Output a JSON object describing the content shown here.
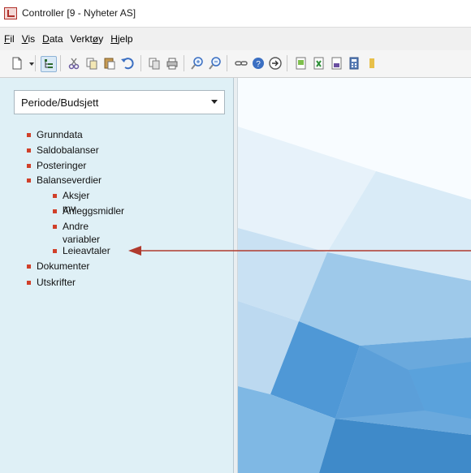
{
  "window": {
    "title": "Controller [9 - Nyheter AS]",
    "icon": "app-icon"
  },
  "menubar": {
    "items": [
      {
        "pre": "",
        "key": "F",
        "post": "il"
      },
      {
        "pre": "",
        "key": "V",
        "post": "is"
      },
      {
        "pre": "",
        "key": "D",
        "post": "ata"
      },
      {
        "pre": "Verkt",
        "key": "ø",
        "post": "y"
      },
      {
        "pre": "",
        "key": "H",
        "post": "jelp"
      }
    ]
  },
  "toolbar": {
    "icons": [
      "new-document-icon",
      "dropdown-arrow-icon",
      "tree-view-icon",
      "cut-icon",
      "copy-icon",
      "paste-icon",
      "undo-icon",
      "copy-report-icon",
      "print-icon",
      "zoom-in-icon",
      "zoom-out-icon",
      "link-icon",
      "help-icon",
      "forward-icon",
      "import-icon",
      "excel-icon",
      "report-icon",
      "calculator-icon"
    ]
  },
  "sidebar": {
    "dropdown": {
      "selected": "Periode/Budsjett"
    },
    "tree": [
      {
        "label": "Grunndata",
        "level": 0
      },
      {
        "label": "Saldobalanser",
        "level": 0
      },
      {
        "label": "Posteringer",
        "level": 0
      },
      {
        "label": "Balanseverdier",
        "level": 0
      },
      {
        "label": "Aksjer mv",
        "level": 1
      },
      {
        "label": "Anleggsmidler",
        "level": 1
      },
      {
        "label": "Andre variabler",
        "level": 1
      },
      {
        "label": "Leieavtaler",
        "level": 1
      },
      {
        "label": "Dokumenter",
        "level": 0
      },
      {
        "label": "Utskrifter",
        "level": 0
      }
    ]
  },
  "colors": {
    "bullet": "#d0402a",
    "arrow": "#b03a2e",
    "panel": "#dff0f6"
  }
}
